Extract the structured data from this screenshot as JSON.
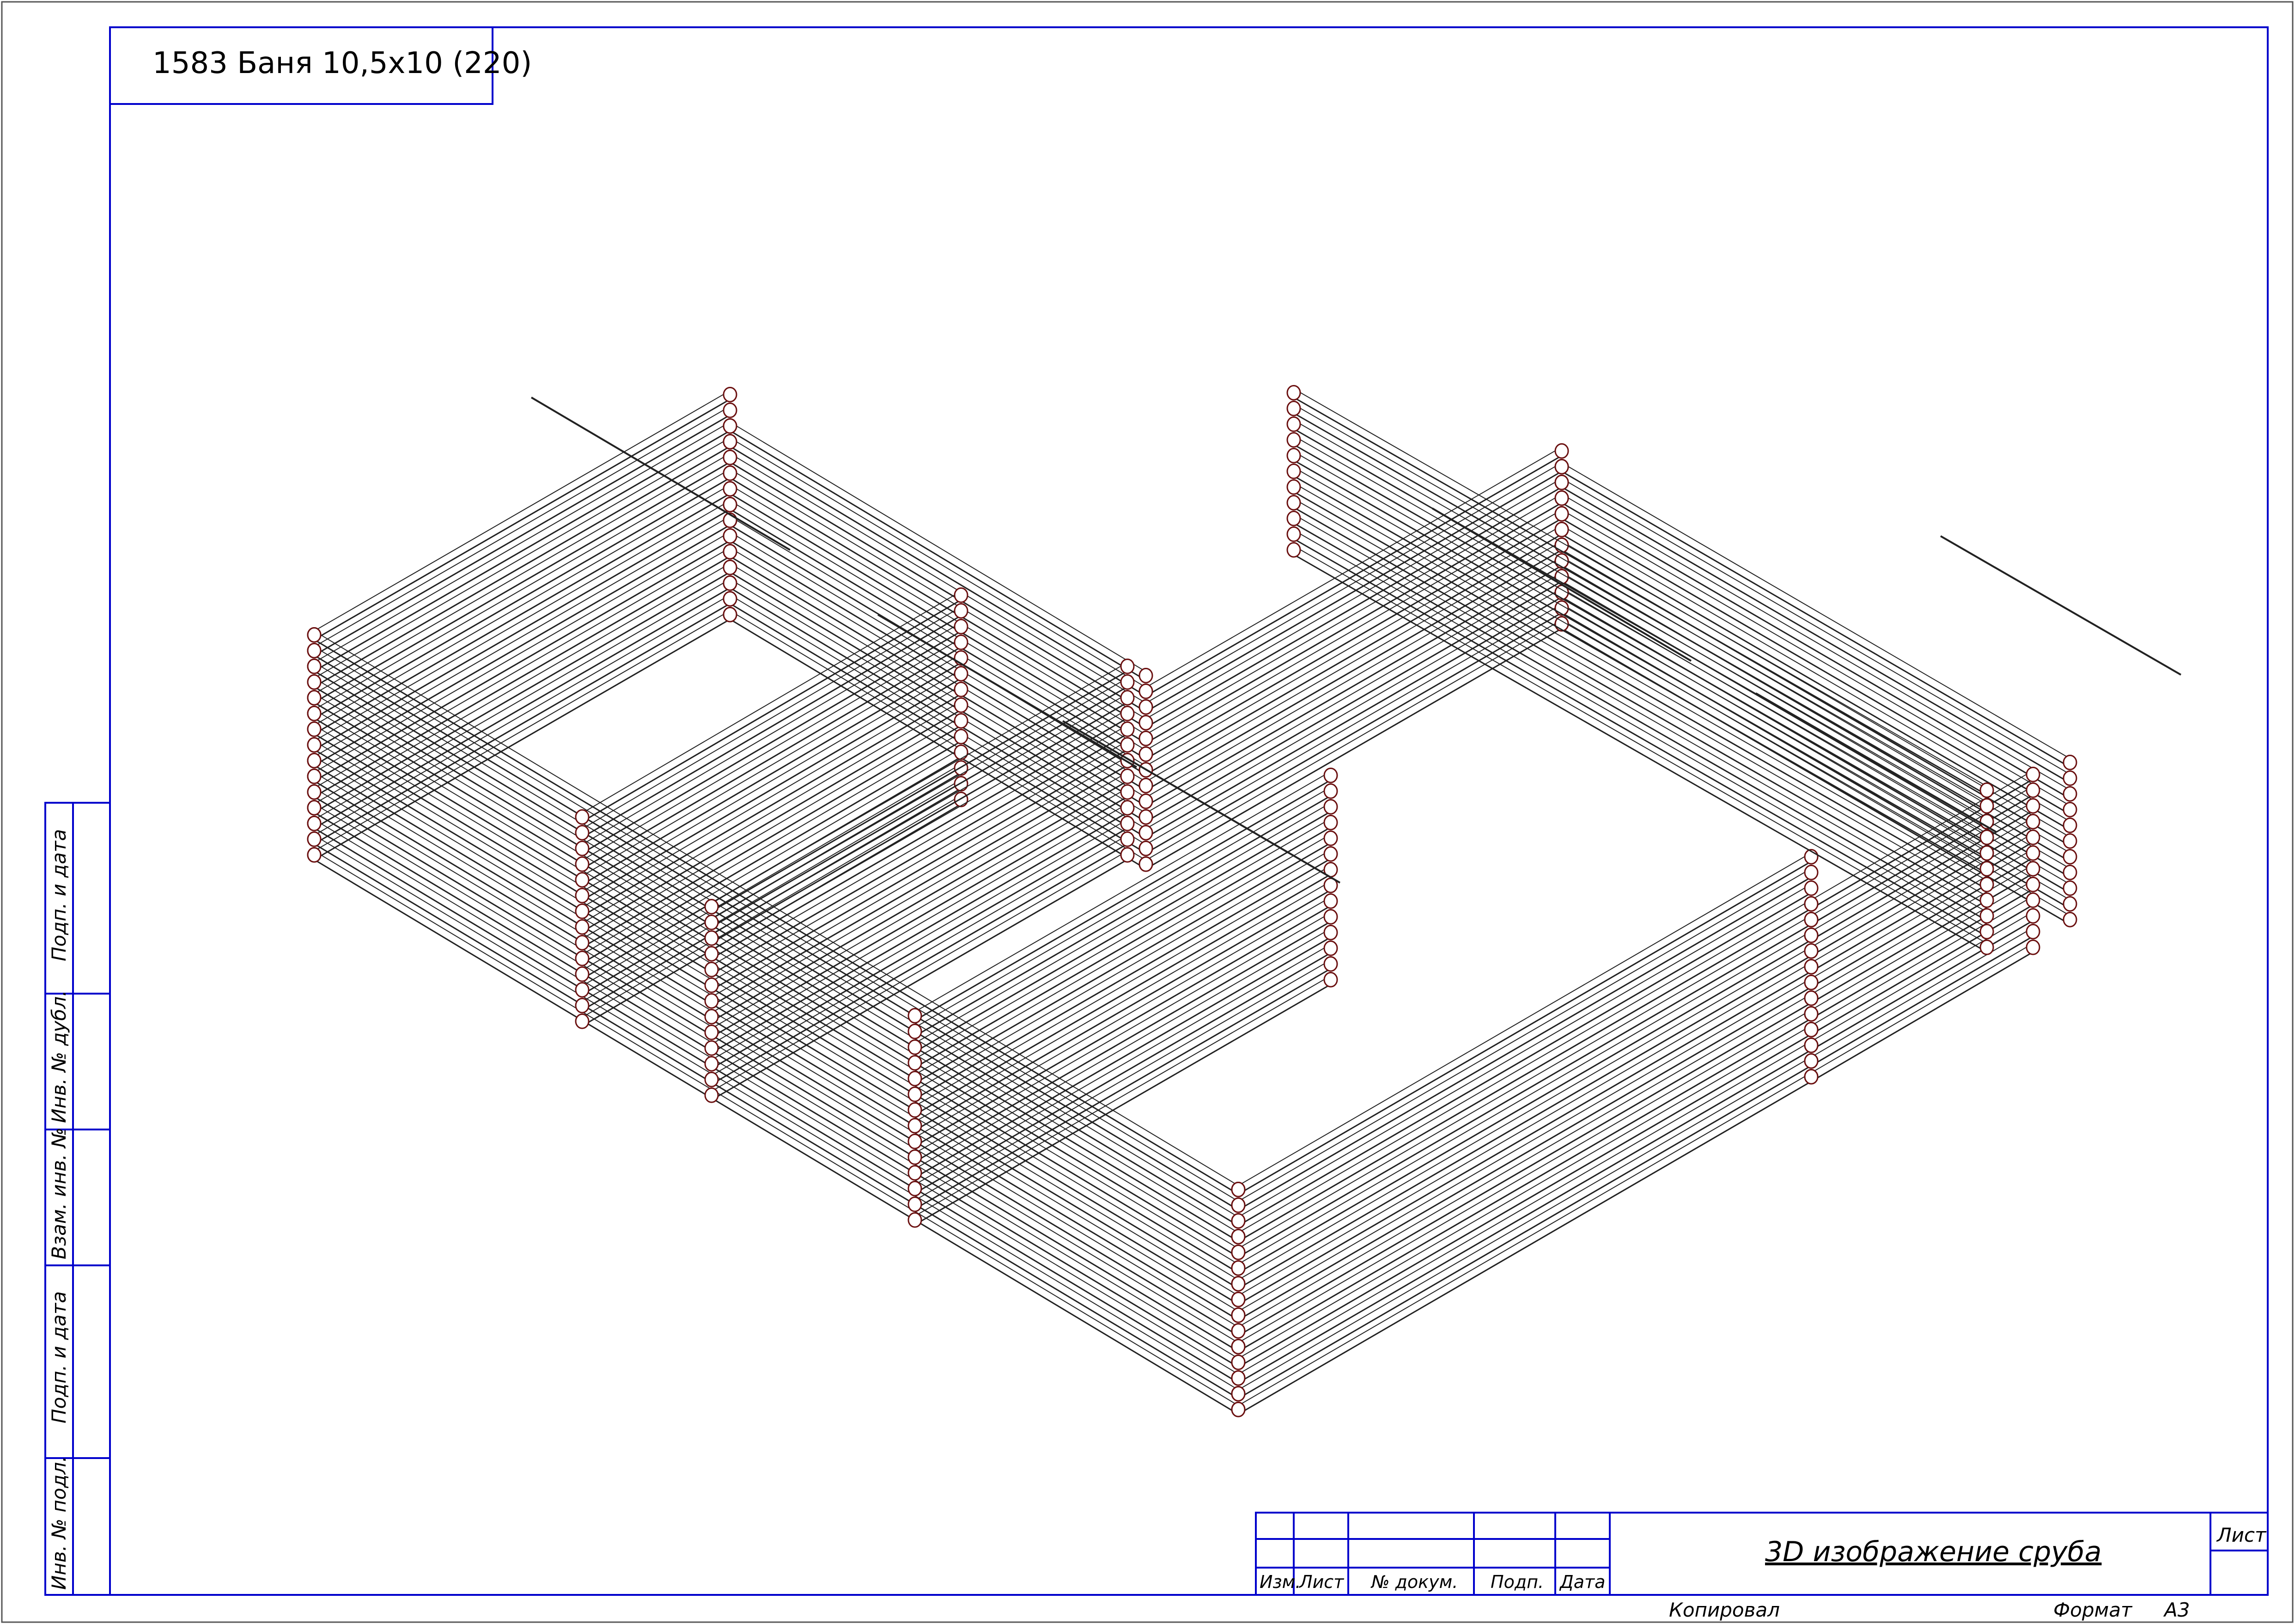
{
  "sheet": {
    "project_title": "1583 Баня 10,5х10 (220)",
    "drawing_title": "3D изображение сруба",
    "copied_label": "Копировал",
    "format_label": "Формат",
    "format_value": "А3",
    "sheet_label": "Лист"
  },
  "title_block_columns": [
    "Изм.",
    "Лист",
    "№ докум.",
    "Подп.",
    "Дата"
  ],
  "side_stamp": {
    "cells": [
      "Подп. и дата",
      "Инв. № дубл.",
      "Взам. инв. №",
      "Подп. и дата",
      "Инв. № подл."
    ]
  },
  "colors": {
    "frame": "#0000cc",
    "log_outline": "#222222",
    "log_end": "#6b1010"
  }
}
